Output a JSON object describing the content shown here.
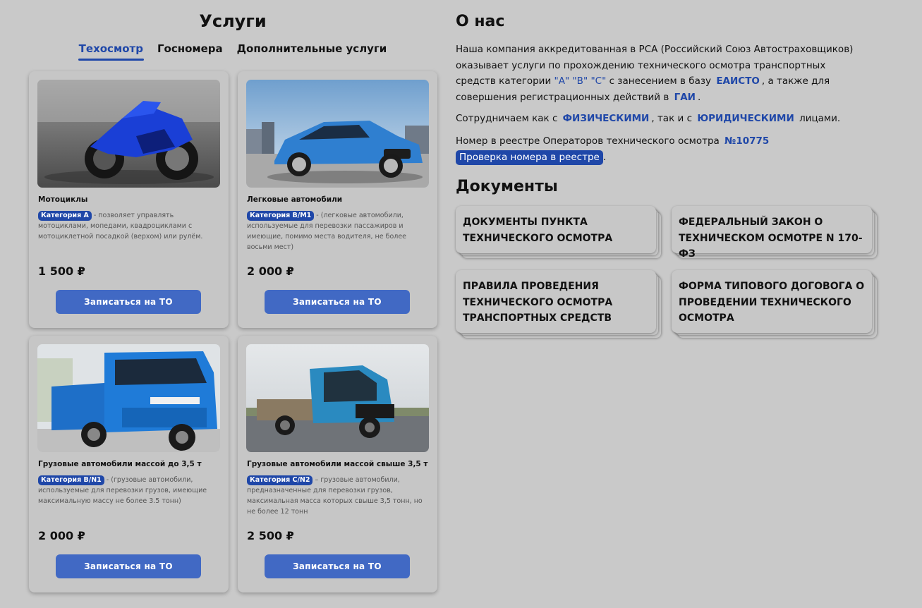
{
  "services": {
    "title": "Услуги",
    "tabs": [
      {
        "label": "Техосмотр",
        "active": true
      },
      {
        "label": "Госномера",
        "active": false
      },
      {
        "label": "Дополнительные услуги",
        "active": false
      }
    ],
    "cards": [
      {
        "image": "motorcycle-photo",
        "title": "Мотоциклы",
        "category": "Категория A",
        "description": " - позволяет управлять мотоциклами, мопедами, квадроциклами с мотоциклетной посадкой (верхом) или рулём.",
        "price": "1 500 ₽",
        "button": "Записаться на ТО"
      },
      {
        "image": "car-photo",
        "title": "Легковые автомобили",
        "category": "Категория B/M1",
        "description": " - (легковые автомобили, используемые для перевозки пассажиров и имеющие, помимо места водителя, не более восьми мест)",
        "price": "2 000 ₽",
        "button": "Записаться на ТО"
      },
      {
        "image": "light-truck-photo",
        "title": "Грузовые автомобили массой до 3,5 т",
        "category": "Категория B/N1",
        "description": " - (грузовые автомобили, используемые для перевозки грузов, имеющие максимальную массу не более 3.5 тонн)",
        "price": "2 000 ₽",
        "button": "Записаться на ТО"
      },
      {
        "image": "heavy-truck-photo",
        "title": "Грузовые автомобили массой свыше 3,5 т",
        "category": "Категория C/N2",
        "description": " – грузовые автомобили, предназначенные для перевозки грузов, максимальная масса которых свыше 3,5 тонн, но не более 12 тонн",
        "price": "2 500 ₽",
        "button": "Записаться на ТО"
      }
    ]
  },
  "about": {
    "title": "О нас",
    "p1_start": "Наша компания аккредитованная в РСА (Российский Союз Автостраховщиков) оказывает услуги по прохождению технического осмотра транспортных средств категории ",
    "p1_cats": "\"A\" \"B\" \"C\"",
    "p1_mid": " с занесением в базу ",
    "p1_eaisto": "ЕАИСТО",
    "p1_mid2": ", а также для совершения регистрационных действий в ",
    "p1_gai": "ГАИ",
    "p1_end": ".",
    "p2_start": "Сотрудничаем как с ",
    "p2_phys": "ФИЗИЧЕСКИМИ",
    "p2_mid": ", так и с ",
    "p2_jur": "ЮРИДИЧЕСКИМИ",
    "p2_end": " лицами.",
    "p3_start": "Номер в реестре Операторов технического осмотра ",
    "p3_number": "№10775",
    "p3_link": "Проверка номера в реестре",
    "p3_end": "."
  },
  "documents": {
    "title": "Документы",
    "items": [
      "ДОКУМЕНТЫ ПУНКТА ТЕХНИЧЕСКОГО ОСМОТРА",
      "ФЕДЕРАЛЬНЫЙ ЗАКОН О ТЕХНИЧЕСКОМ ОСМОТРЕ N 170-ФЗ",
      "ПРАВИЛА ПРОВЕДЕНИЯ ТЕХНИЧЕСКОГО ОСМОТРА ТРАНСПОРТНЫХ СРЕДСТВ",
      "ФОРМА ТИПОВОГО ДОГОВОГА О ПРОВЕДЕНИИ ТЕХНИЧЕСКОГО ОСМОТРА"
    ]
  },
  "colors": {
    "background": "#c9c9c9",
    "accent": "#1f47a8",
    "button": "#4169c4"
  }
}
